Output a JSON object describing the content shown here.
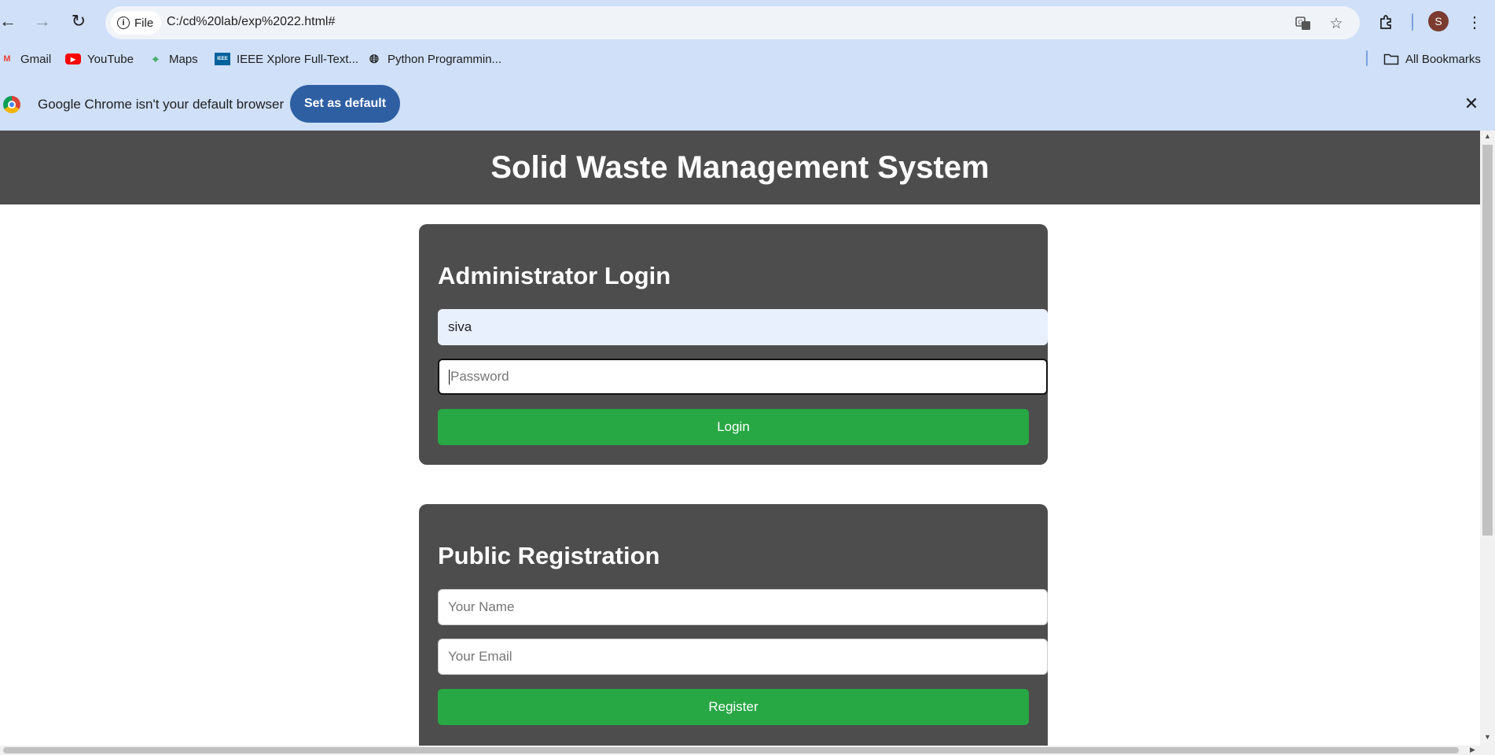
{
  "browser": {
    "url": "C:/cd%20lab/exp%2022.html#",
    "site_chip_label": "File",
    "profile_initial": "S",
    "bookmarks": [
      {
        "label": "Gmail",
        "icon": "gmail-icon"
      },
      {
        "label": "YouTube",
        "icon": "youtube-icon"
      },
      {
        "label": "Maps",
        "icon": "maps-icon"
      },
      {
        "label": "IEEE Xplore Full-Text...",
        "icon": "ieee-icon"
      },
      {
        "label": "Python Programmin...",
        "icon": "globe-icon"
      }
    ],
    "all_bookmarks_label": "All Bookmarks",
    "infobar_message": "Google Chrome isn't your default browser",
    "set_default_label": "Set as default"
  },
  "page": {
    "title": "Solid Waste Management System",
    "login": {
      "heading": "Administrator Login",
      "username_value": "siva",
      "password_placeholder": "Password",
      "button_label": "Login"
    },
    "registration": {
      "heading": "Public Registration",
      "name_placeholder": "Your Name",
      "email_placeholder": "Your Email",
      "button_label": "Register"
    }
  },
  "colors": {
    "header_bg": "#4d4d4d",
    "button_green": "#28a745",
    "chrome_bar": "#cfe0f8",
    "set_default_button": "#2e5fa3"
  }
}
